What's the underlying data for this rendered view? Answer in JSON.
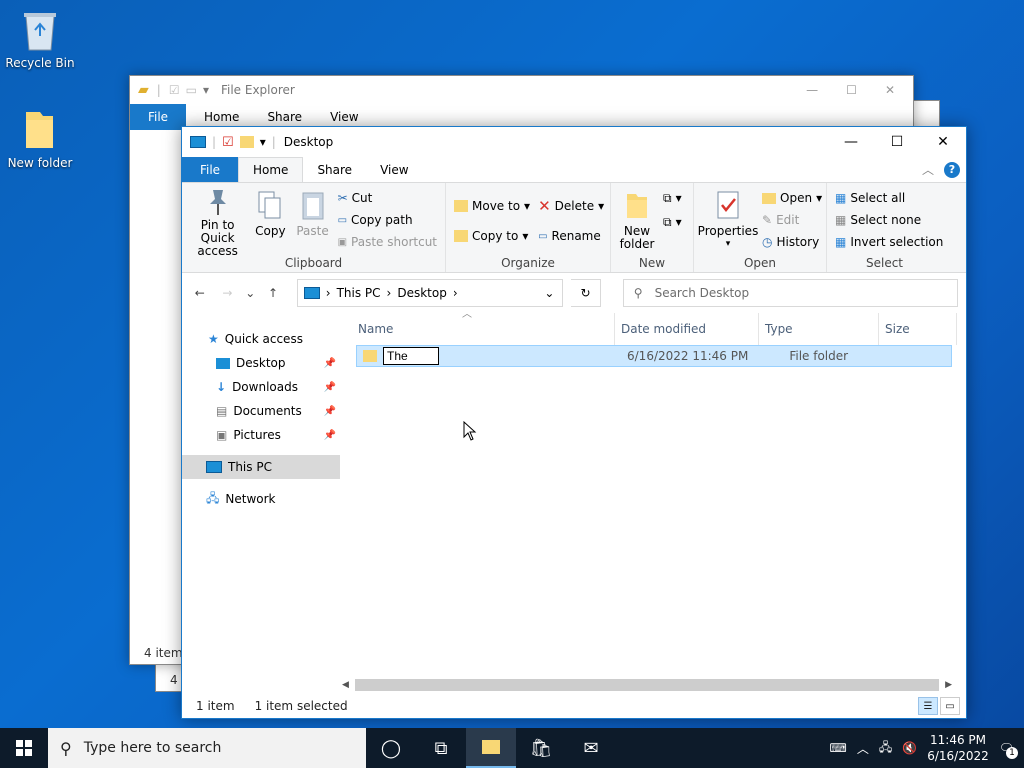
{
  "desktop": {
    "icons": [
      {
        "label": "Recycle Bin"
      },
      {
        "label": "New folder"
      }
    ]
  },
  "back_window": {
    "title": "File Explorer",
    "tabs": [
      "File",
      "Home",
      "Share",
      "View"
    ],
    "status": "4 items",
    "status2": "4 i"
  },
  "window": {
    "title": "Desktop",
    "tabs": {
      "file": "File",
      "home": "Home",
      "share": "Share",
      "view": "View"
    },
    "ribbon": {
      "clipboard": {
        "name": "Clipboard",
        "pin": "Pin to Quick access",
        "copy": "Copy",
        "paste": "Paste",
        "cut": "Cut",
        "copy_path": "Copy path",
        "paste_shortcut": "Paste shortcut"
      },
      "organize": {
        "name": "Organize",
        "move_to": "Move to",
        "copy_to": "Copy to",
        "delete": "Delete",
        "rename": "Rename"
      },
      "new": {
        "name": "New",
        "new_folder": "New folder"
      },
      "open": {
        "name": "Open",
        "properties": "Properties",
        "open": "Open",
        "edit": "Edit",
        "history": "History"
      },
      "select": {
        "name": "Select",
        "select_all": "Select all",
        "select_none": "Select none",
        "invert": "Invert selection"
      }
    },
    "address": {
      "crumbs": [
        "This PC",
        "Desktop"
      ]
    },
    "search": {
      "placeholder": "Search Desktop"
    },
    "nav": {
      "quick_access": "Quick access",
      "items": [
        "Desktop",
        "Downloads",
        "Documents",
        "Pictures"
      ],
      "this_pc": "This PC",
      "network": "Network"
    },
    "columns": {
      "name": "Name",
      "date": "Date modified",
      "type": "Type",
      "size": "Size"
    },
    "row": {
      "name_edit": "The",
      "date": "6/16/2022 11:46 PM",
      "type": "File folder"
    },
    "status": {
      "count": "1 item",
      "selected": "1 item selected"
    }
  },
  "taskbar": {
    "search_placeholder": "Type here to search",
    "time": "11:46 PM",
    "date": "6/16/2022",
    "notif_count": "1"
  },
  "colors": {
    "accent": "#1979ca",
    "selection": "#cce8ff",
    "taskbar": "#0d1b2a"
  }
}
